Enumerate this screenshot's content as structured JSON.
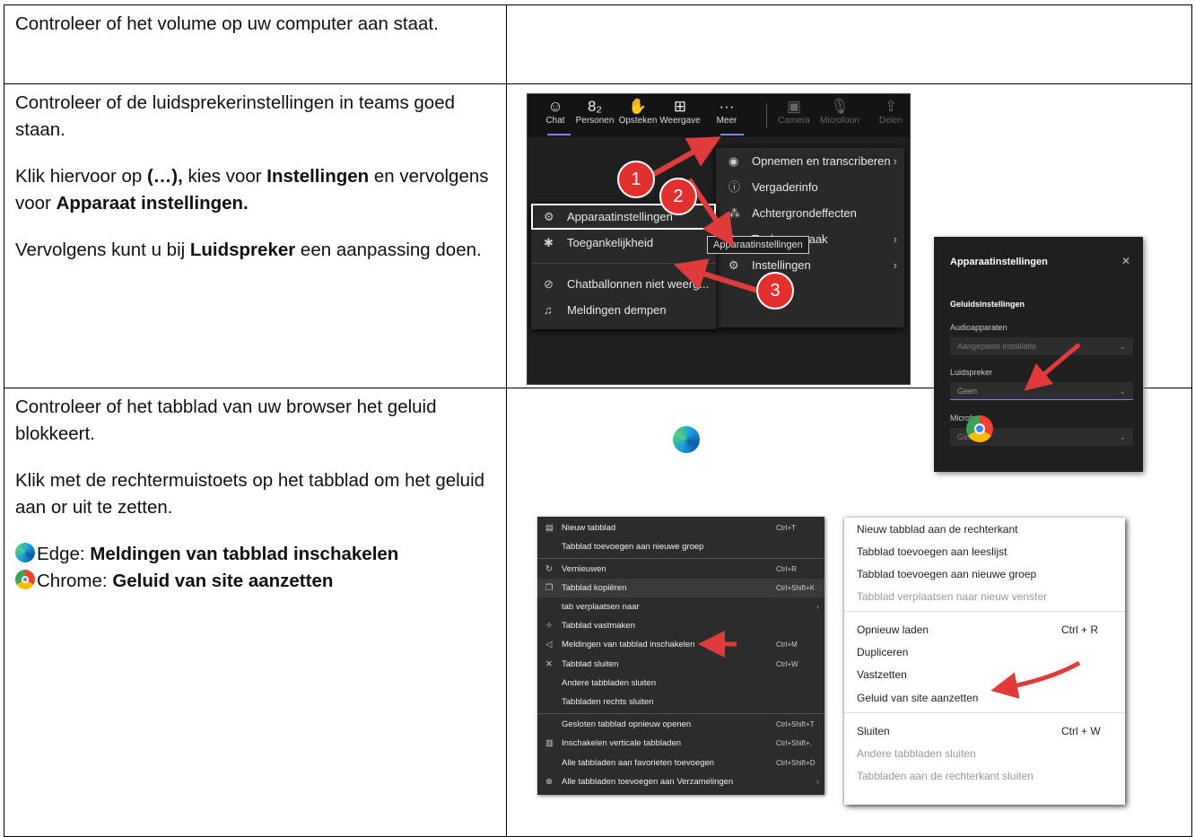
{
  "rows": [
    {
      "text": "Controleer of het volume op uw computer aan staat."
    },
    {
      "p1": "Controleer of de luidsprekerinstellingen in teams goed staan.",
      "p2_a": "Klik hiervoor op ",
      "p2_b": "(…),",
      "p2_c": " kies voor ",
      "p2_d": "Instellingen",
      "p2_e": " en vervolgens voor ",
      "p2_f": "Apparaat instellingen.",
      "p3_a": "Vervolgens kunt u bij ",
      "p3_b": "Luidspreker",
      "p3_c": " een aanpassing doen."
    },
    {
      "p1": "Controleer of het tabblad van uw browser het geluid blokkeert.",
      "p2": "Klik met de rechtermuistoets op het tabblad om het geluid aan or uit te zetten.",
      "edge_a": "Edge: ",
      "edge_b": "Meldingen van tabblad inschakelen",
      "chrome_a": "Chrome: ",
      "chrome_b": "Geluid van site aanzetten"
    }
  ],
  "teams": {
    "toolbar": [
      {
        "icon": "☺",
        "label": "Chat"
      },
      {
        "icon": "8₂",
        "label": "Personen"
      },
      {
        "icon": "✋",
        "label": "Opsteken"
      },
      {
        "icon": "⊞",
        "label": "Weergave"
      },
      {
        "icon": "···",
        "label": "Meer"
      },
      {
        "icon": "▣",
        "label": "Camera"
      },
      {
        "icon": "🎙",
        "label": "Microfoon"
      },
      {
        "icon": "⇪",
        "label": "Delen"
      }
    ],
    "more_menu": [
      "Opnemen en transcriberen",
      "Vergaderinfo",
      "Achtergrondeffecten",
      "Taal en spraak",
      "Instellingen"
    ],
    "settings_menu": [
      "Apparaatinstellingen",
      "Toegankelijkheid",
      "Chatballonnen niet weerg...",
      "Meldingen dempen"
    ],
    "tooltip": "Apparaatinstellingen",
    "badges": [
      "1",
      "2",
      "3"
    ]
  },
  "device": {
    "title": "Apparaatinstellingen",
    "section": "Geluidsinstellingen",
    "audio_label": "Audioapparaten",
    "audio_value": "Aangepaste installatie",
    "speaker_label": "Luidspreker",
    "speaker_value": "Geen",
    "mic_label": "Microfoon",
    "mic_value": "Geen"
  },
  "edge_menu": [
    {
      "label": "Nieuw tabblad",
      "shortcut": "Ctrl+T"
    },
    {
      "label": "Tabblad toevoegen aan nieuwe groep",
      "shortcut": ""
    },
    {
      "label": "Vernieuwen",
      "shortcut": "Ctrl+R"
    },
    {
      "label": "Tabblad kopiëren",
      "shortcut": "Ctrl+Shift+K"
    },
    {
      "label": "tab verplaatsen naar",
      "shortcut": ""
    },
    {
      "label": "Tabblad vastmaken",
      "shortcut": ""
    },
    {
      "label": "Meldingen van tabblad inschakelen",
      "shortcut": "Ctrl+M"
    },
    {
      "label": "Tabblad sluiten",
      "shortcut": "Ctrl+W"
    },
    {
      "label": "Andere tabbladen sluiten",
      "shortcut": ""
    },
    {
      "label": "Tabbladen rechts sluiten",
      "shortcut": ""
    },
    {
      "label": "Gesloten tabblad opnieuw openen",
      "shortcut": "Ctrl+Shift+T"
    },
    {
      "label": "Inschakelen verticale tabbladen",
      "shortcut": "Ctrl+Shift+,"
    },
    {
      "label": "Alle tabbladen aan favorieten toevoegen",
      "shortcut": "Ctrl+Shift+D"
    },
    {
      "label": "Alle tabbladen toevoegen aan Verzamelingen",
      "shortcut": ""
    }
  ],
  "chrome_menu": [
    {
      "label": "Nieuw tabblad aan de rechterkant",
      "shortcut": ""
    },
    {
      "label": "Tabblad toevoegen aan leeslijst",
      "shortcut": ""
    },
    {
      "label": "Tabblad toevoegen aan nieuwe groep",
      "shortcut": ""
    },
    {
      "label": "Tabblad verplaatsen naar nieuw venster",
      "shortcut": ""
    },
    {
      "label": "Opnieuw laden",
      "shortcut": "Ctrl + R"
    },
    {
      "label": "Dupliceren",
      "shortcut": ""
    },
    {
      "label": "Vastzetten",
      "shortcut": ""
    },
    {
      "label": "Geluid van site aanzetten",
      "shortcut": ""
    },
    {
      "label": "Sluiten",
      "shortcut": "Ctrl + W"
    },
    {
      "label": "Andere tabbladen sluiten",
      "shortcut": ""
    },
    {
      "label": "Tabbladen aan de rechterkant sluiten",
      "shortcut": ""
    }
  ],
  "colors": {
    "arrow": "#e03a3a",
    "teams_bg": "#1f1f1f"
  }
}
